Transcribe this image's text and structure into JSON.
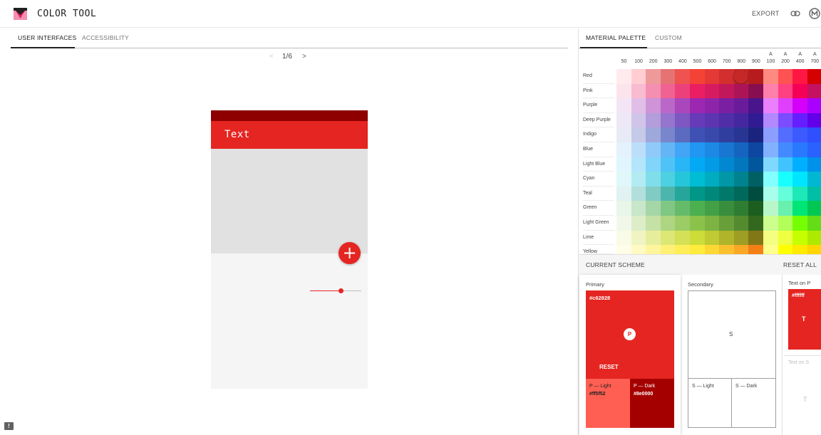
{
  "app": {
    "title": "COLOR TOOL"
  },
  "header": {
    "export_label": "EXPORT"
  },
  "left_tabs": [
    {
      "label": "USER INTERFACES",
      "active": true
    },
    {
      "label": "ACCESSIBILITY",
      "active": false
    }
  ],
  "pager": {
    "prev": "<",
    "page": "1/6",
    "next": ">"
  },
  "phone": {
    "appbar_title": "Text",
    "fab_symbol": "+"
  },
  "right_tabs": [
    {
      "label": "MATERIAL PALETTE",
      "active": true
    },
    {
      "label": "CUSTOM",
      "active": false
    }
  ],
  "palette": {
    "shades": [
      "50",
      "100",
      "200",
      "300",
      "400",
      "500",
      "600",
      "700",
      "800",
      "900",
      "A\n100",
      "A\n200",
      "A\n400",
      "A\n700"
    ],
    "selected": {
      "hue": "Red",
      "shade": "800"
    },
    "hues": [
      {
        "name": "Red",
        "colors": [
          "#ffebee",
          "#ffcdd2",
          "#ef9a9a",
          "#e57373",
          "#ef5350",
          "#f44336",
          "#e53935",
          "#d32f2f",
          "#c62828",
          "#b71c1c",
          "#ff8a80",
          "#ff5252",
          "#ff1744",
          "#d50000"
        ]
      },
      {
        "name": "Pink",
        "colors": [
          "#fce4ec",
          "#f8bbd0",
          "#f48fb1",
          "#f06292",
          "#ec407a",
          "#e91e63",
          "#d81b60",
          "#c2185b",
          "#ad1457",
          "#880e4f",
          "#ff80ab",
          "#ff4081",
          "#f50057",
          "#c51162"
        ]
      },
      {
        "name": "Purple",
        "colors": [
          "#f3e5f5",
          "#e1bee7",
          "#ce93d8",
          "#ba68c8",
          "#ab47bc",
          "#9c27b0",
          "#8e24aa",
          "#7b1fa2",
          "#6a1b9a",
          "#4a148c",
          "#ea80fc",
          "#e040fb",
          "#d500f9",
          "#aa00ff"
        ]
      },
      {
        "name": "Deep Purple",
        "colors": [
          "#ede7f6",
          "#d1c4e9",
          "#b39ddb",
          "#9575cd",
          "#7e57c2",
          "#673ab7",
          "#5e35b1",
          "#512da8",
          "#4527a0",
          "#311b92",
          "#b388ff",
          "#7c4dff",
          "#651fff",
          "#6200ea"
        ]
      },
      {
        "name": "Indigo",
        "colors": [
          "#e8eaf6",
          "#c5cae9",
          "#9fa8da",
          "#7986cb",
          "#5c6bc0",
          "#3f51b5",
          "#3949ab",
          "#303f9f",
          "#283593",
          "#1a237e",
          "#8c9eff",
          "#536dfe",
          "#3d5afe",
          "#304ffe"
        ]
      },
      {
        "name": "Blue",
        "colors": [
          "#e3f2fd",
          "#bbdefb",
          "#90caf9",
          "#64b5f6",
          "#42a5f5",
          "#2196f3",
          "#1e88e5",
          "#1976d2",
          "#1565c0",
          "#0d47a1",
          "#82b1ff",
          "#448aff",
          "#2979ff",
          "#2962ff"
        ]
      },
      {
        "name": "Light Blue",
        "colors": [
          "#e1f5fe",
          "#b3e5fc",
          "#81d4fa",
          "#4fc3f7",
          "#29b6f6",
          "#03a9f4",
          "#039be5",
          "#0288d1",
          "#0277bd",
          "#01579b",
          "#80d8ff",
          "#40c4ff",
          "#00b0ff",
          "#0091ea"
        ]
      },
      {
        "name": "Cyan",
        "colors": [
          "#e0f7fa",
          "#b2ebf2",
          "#80deea",
          "#4dd0e1",
          "#26c6da",
          "#00bcd4",
          "#00acc1",
          "#0097a7",
          "#00838f",
          "#006064",
          "#84ffff",
          "#18ffff",
          "#00e5ff",
          "#00b8d4"
        ]
      },
      {
        "name": "Teal",
        "colors": [
          "#e0f2f1",
          "#b2dfdb",
          "#80cbc4",
          "#4db6ac",
          "#26a69a",
          "#009688",
          "#00897b",
          "#00796b",
          "#00695c",
          "#004d40",
          "#a7ffeb",
          "#64ffda",
          "#1de9b6",
          "#00bfa5"
        ]
      },
      {
        "name": "Green",
        "colors": [
          "#e8f5e9",
          "#c8e6c9",
          "#a5d6a7",
          "#81c784",
          "#66bb6a",
          "#4caf50",
          "#43a047",
          "#388e3c",
          "#2e7d32",
          "#1b5e20",
          "#b9f6ca",
          "#69f0ae",
          "#00e676",
          "#00c853"
        ]
      },
      {
        "name": "Light Green",
        "colors": [
          "#f1f8e9",
          "#dcedc8",
          "#c5e1a5",
          "#aed581",
          "#9ccc65",
          "#8bc34a",
          "#7cb342",
          "#689f38",
          "#558b2f",
          "#33691e",
          "#ccff90",
          "#b2ff59",
          "#76ff03",
          "#64dd17"
        ]
      },
      {
        "name": "Lime",
        "colors": [
          "#f9fbe7",
          "#f0f4c3",
          "#e6ee9c",
          "#dce775",
          "#d4e157",
          "#cddc39",
          "#c0ca33",
          "#afb42b",
          "#9e9d24",
          "#827717",
          "#f4ff81",
          "#eeff41",
          "#c6ff00",
          "#aeea00"
        ]
      },
      {
        "name": "Yellow",
        "colors": [
          "#fffde7",
          "#fff9c4",
          "#fff59d",
          "#fff176",
          "#ffee58",
          "#ffeb3b",
          "#fdd835",
          "#fbc02d",
          "#f9a825",
          "#f57f17",
          "#ffff8d",
          "#ffff00",
          "#ffea00",
          "#ffd600"
        ]
      }
    ]
  },
  "scheme": {
    "title": "CURRENT SCHEME",
    "reset_all": "RESET ALL",
    "primary": {
      "label": "Primary",
      "hex": "#c62828",
      "badge": "P",
      "reset": "RESET",
      "light_name": "P — Light",
      "light_hex": "#ff5f52",
      "dark_name": "P — Dark",
      "dark_hex": "#8e0000"
    },
    "secondary": {
      "label": "Secondary",
      "badge": "S",
      "light_name": "S — Light",
      "dark_name": "S — Dark"
    },
    "text_on": {
      "primary_label": "Text on P",
      "primary_hex": "#ffffff",
      "primary_letter": "T",
      "secondary_label": "Text on S",
      "secondary_letter": "T"
    }
  },
  "colors": {
    "primary": "#e52521",
    "primary_dark": "#8e0000",
    "hero_gray": "#e0e1e0"
  }
}
